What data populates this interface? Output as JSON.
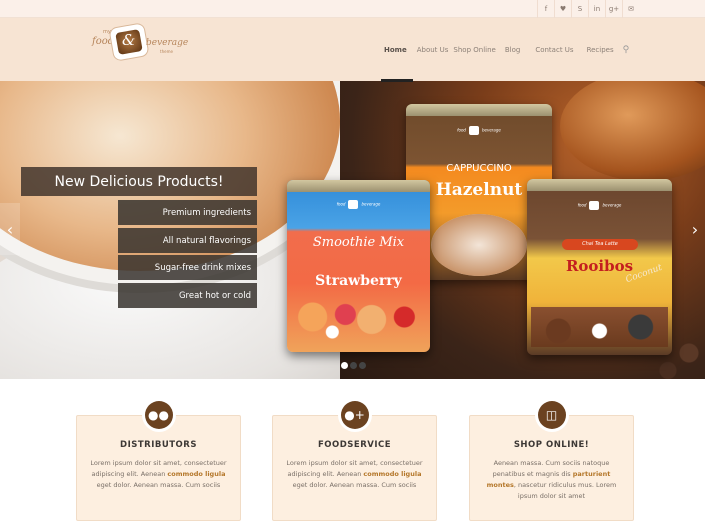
{
  "topbar": {
    "social": [
      {
        "icon": "facebook-icon",
        "glyph": "f"
      },
      {
        "icon": "twitter-icon",
        "glyph": "🐦"
      },
      {
        "icon": "skype-icon",
        "glyph": "S"
      },
      {
        "icon": "linkedin-icon",
        "glyph": "in"
      },
      {
        "icon": "google-plus-icon",
        "glyph": "g+"
      },
      {
        "icon": "mail-icon",
        "glyph": "✉"
      }
    ]
  },
  "logo": {
    "my": "my",
    "food": "food",
    "amp": "&",
    "beverage": "beverage",
    "theme": "theme"
  },
  "nav": {
    "items": [
      "Home",
      "About Us",
      "Shop Online",
      "Blog",
      "Contact Us",
      "Recipes"
    ],
    "active": "Home",
    "search_glyph": "⚲"
  },
  "slider": {
    "title": "New Delicious Products!",
    "features": [
      "Premium ingredients",
      "All natural flavorings",
      "Sugar-free drink mixes",
      "Great hot or cold"
    ],
    "prev_glyph": "‹",
    "next_glyph": "›",
    "slide_count": 3,
    "active_slide": 1,
    "cans": {
      "strawberry": {
        "brand_left": "food",
        "brand_right": "beverage",
        "line1": "Smoothie Mix",
        "line2": "Strawberry"
      },
      "hazelnut": {
        "brand_left": "food",
        "brand_right": "beverage",
        "line1": "CAPPUCCINO",
        "line2": "Hazelnut"
      },
      "rooibos": {
        "brand_left": "food",
        "brand_right": "beverage",
        "badge": "Chai Tea Latte",
        "line1": "Rooibos",
        "line2": "Coconut"
      }
    }
  },
  "features": [
    {
      "title": "DISTRIBUTORS",
      "icon": "users-icon",
      "glyph": "👥",
      "text_before": "Lorem ipsum dolor sit amet, consectetuer adipiscing elit. Aenean ",
      "link": "commodo ligula",
      "text_after": " eget dolor. Aenean massa. Cum sociis"
    },
    {
      "title": "FOODSERVICE",
      "icon": "add-user-icon",
      "glyph": "👤+",
      "text_before": "Lorem ipsum dolor sit amet, consectetuer adipiscing elit. Aenean ",
      "link": "commodo ligula",
      "text_after": " eget dolor. Aenean massa. Cum sociis"
    },
    {
      "title": "SHOP ONLINE!",
      "icon": "cart-icon",
      "glyph": "🛒",
      "text_before": "Aenean massa. Cum sociis natoque penatibus et magnis dis ",
      "link": "parturient montes",
      "text_after": ", nascetur ridiculus mus. Lorem ipsum dolor sit amet"
    }
  ]
}
